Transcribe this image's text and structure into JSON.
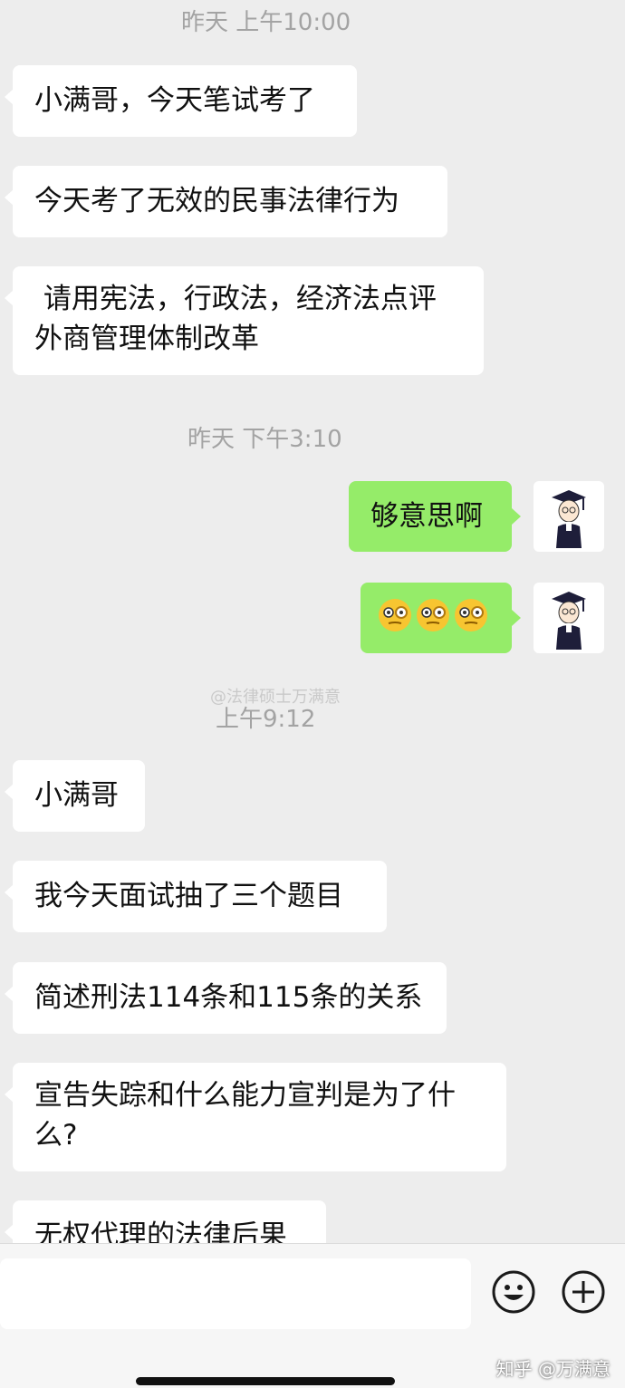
{
  "timestamps": [
    "昨天 上午10:00",
    "昨天 下午3:10",
    "上午9:12"
  ],
  "watermark": "@法律硕士万满意",
  "messages": [
    {
      "side": "in",
      "text": "小满哥，今天笔试考了"
    },
    {
      "side": "in",
      "text": "今天考了无效的民事法律行为"
    },
    {
      "side": "in",
      "line1": " 请用宪法，行政法，经济法点评",
      "line2": "外商管理体制改革"
    },
    {
      "side": "out",
      "text": "够意思啊"
    },
    {
      "side": "out",
      "emoji": [
        "face-with-monocle-emoji",
        "face-with-monocle-emoji",
        "face-with-monocle-emoji"
      ]
    },
    {
      "side": "in",
      "text": "小满哥"
    },
    {
      "side": "in",
      "text": "我今天面试抽了三个题目"
    },
    {
      "side": "in",
      "text": "简述刑法114条和115条的关系"
    },
    {
      "side": "in",
      "line1": "宣告失踪和什么能力宣判是为了什",
      "line2": "么?"
    },
    {
      "side": "in",
      "text": "无权代理的法律后果"
    }
  ],
  "input_bar": {
    "icons": [
      "smiley-icon",
      "plus-icon"
    ]
  },
  "site_watermark": "知乎 @万满意",
  "colors": {
    "background": "#ededed",
    "incoming_bubble": "#ffffff",
    "outgoing_bubble": "#95ec69",
    "timestamp": "#a3a3a3"
  }
}
